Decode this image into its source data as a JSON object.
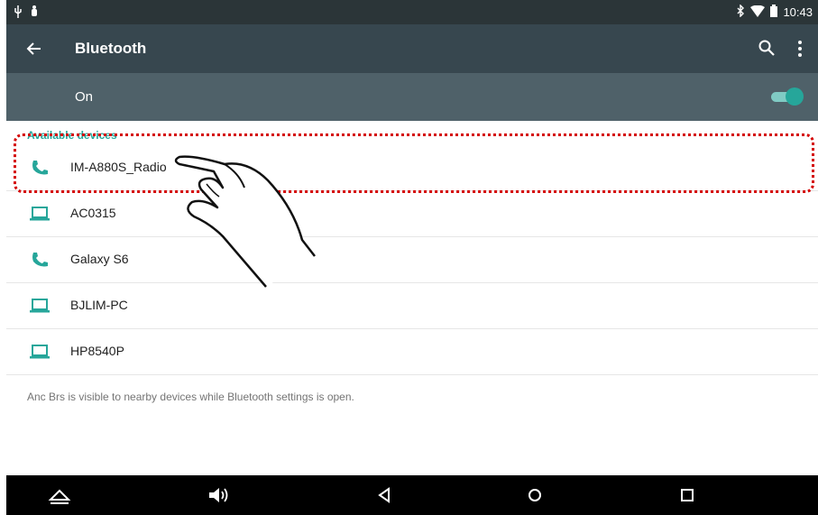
{
  "status_bar": {
    "time": "10:43",
    "left_icons": [
      "usb-icon",
      "android-debug-icon"
    ],
    "right_icons": [
      "bluetooth-icon",
      "wifi-icon",
      "battery-icon"
    ]
  },
  "toolbar": {
    "title": "Bluetooth",
    "back_icon": "arrow-back-icon",
    "actions": [
      "search-icon",
      "more-vert-icon"
    ]
  },
  "bluetooth_switch": {
    "label": "On",
    "checked": true
  },
  "available_devices": {
    "header": "Available devices",
    "items": [
      {
        "name": "IM-A880S_Radio",
        "icon": "phone-icon"
      },
      {
        "name": "AC0315",
        "icon": "laptop-icon"
      },
      {
        "name": "Galaxy S6",
        "icon": "phone-icon"
      },
      {
        "name": "BJLIM-PC",
        "icon": "laptop-icon"
      },
      {
        "name": "HP8540P",
        "icon": "laptop-icon"
      }
    ]
  },
  "footer_note": "Anc Brs is visible to nearby devices while Bluetooth settings is open.",
  "nav_bar": {
    "buttons": [
      "hide-nav-icon",
      "volume-icon",
      "back-triangle-icon",
      "home-circle-icon",
      "recents-square-icon"
    ]
  },
  "colors": {
    "status_bar": "#2b3538",
    "toolbar": "#37474f",
    "switch_bar": "#4f6169",
    "accent": "#26a69a",
    "highlight": "#d40000"
  }
}
